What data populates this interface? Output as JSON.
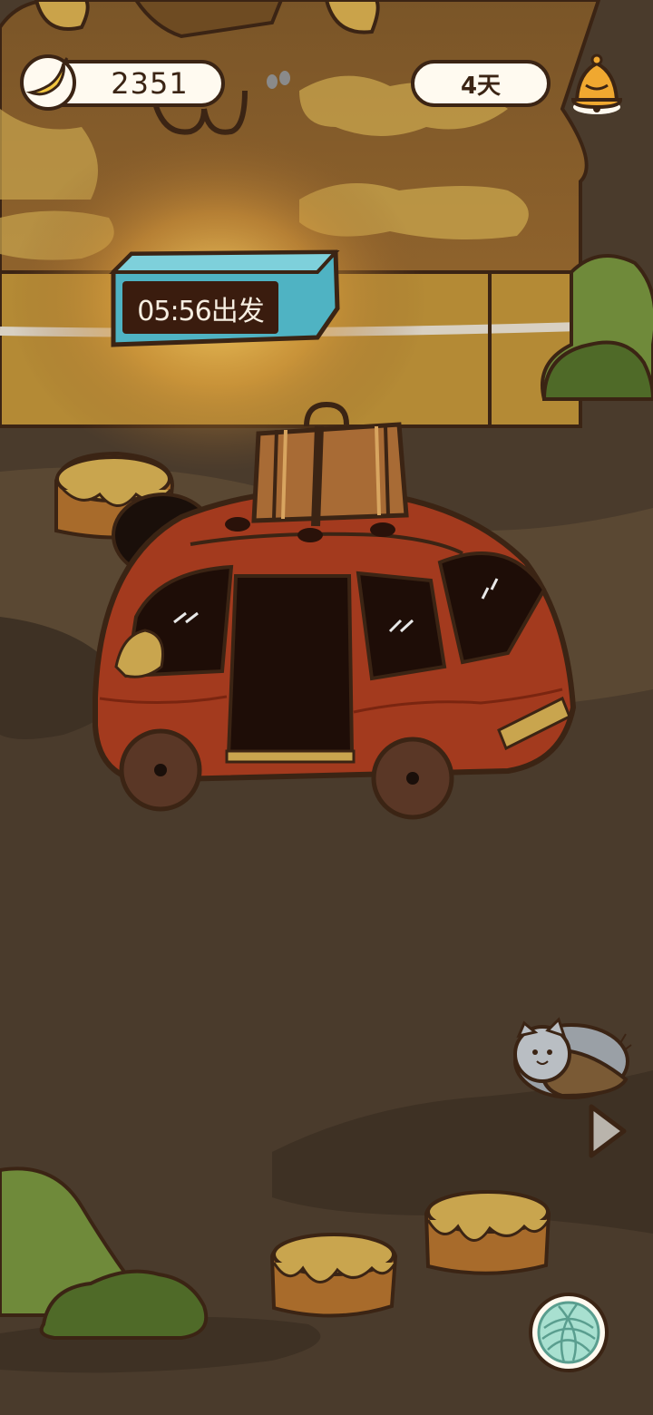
{
  "hud": {
    "banana_icon": "banana-icon",
    "banana_count": "2351",
    "days_label": "4天",
    "bell_icon": "bell-icon"
  },
  "departure_sign": {
    "text": "05:56出发"
  },
  "controls": {
    "next_icon": "play-arrow-icon",
    "yarn_icon": "yarn-ball-icon"
  },
  "colors": {
    "background": "#4a3b2c",
    "outline": "#3b2414",
    "pill_fill": "#fffaf0",
    "bus_red": "#a33a1e",
    "sign_teal": "#4fb3c3",
    "glow": "#f7d46a"
  }
}
